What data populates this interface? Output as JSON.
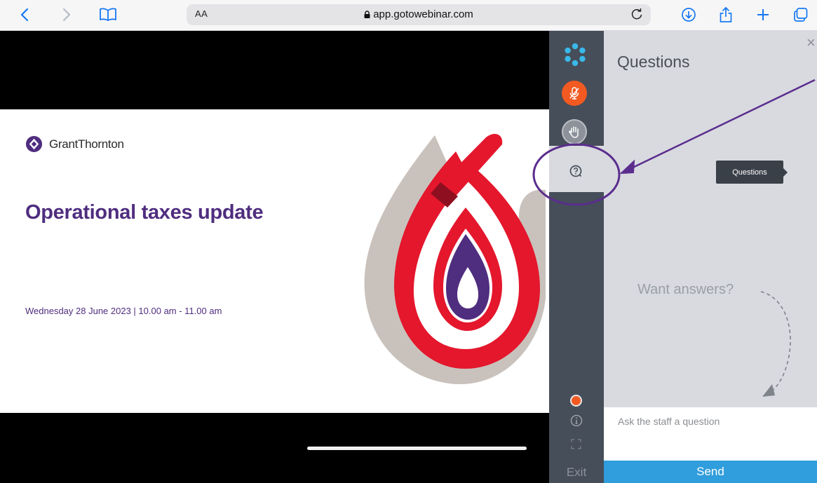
{
  "browser": {
    "text_size_label": "AA",
    "url": "app.gotowebinar.com"
  },
  "slide": {
    "brand": "GrantThornton",
    "title": "Operational taxes update",
    "subtitle": "Wednesday 28 June 2023  |  10.00 am - 11.00 am"
  },
  "sidebar": {
    "exit_label": "Exit"
  },
  "panel": {
    "title": "Questions",
    "close_glyph": "×",
    "tooltip": "Questions",
    "empty_hint": "Want answers?",
    "input_placeholder": "Ask the staff a question",
    "send_label": "Send"
  },
  "colors": {
    "accent": "#309ddc",
    "brand_purple": "#4f2d7f",
    "mic_orange": "#f25a22",
    "rail": "#464e59",
    "annotation": "#5b2d8e"
  }
}
